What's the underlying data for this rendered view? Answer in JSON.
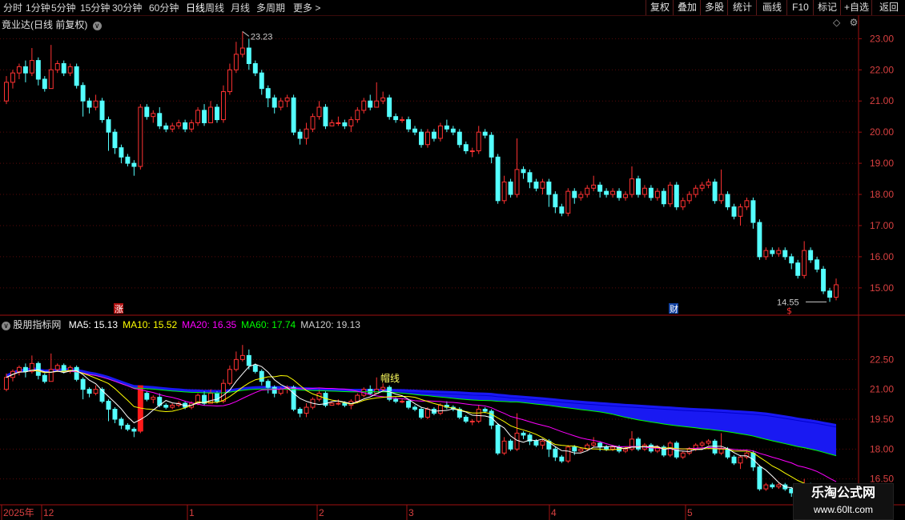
{
  "toolbar": {
    "periods": [
      "分时",
      "1分钟",
      "5分钟",
      "15分钟",
      "30分钟",
      "60分钟",
      "日线",
      "周线",
      "月线",
      "多周期",
      "更多 >"
    ],
    "active_period": "日线",
    "buttons": [
      "复权",
      "叠加",
      "多股",
      "统计",
      "画线",
      "F10",
      "标记",
      "+自选",
      "返回"
    ]
  },
  "main_panel": {
    "title": "竟业达(日线 前复权)",
    "high_label": "23.23",
    "low_label": "14.55",
    "limit_up_tag": "涨",
    "finance_tag": "财",
    "dollar_tag": "$",
    "price_ticks": [
      "23.00",
      "22.00",
      "21.00",
      "20.00",
      "19.00",
      "18.00",
      "17.00",
      "16.00",
      "15.00"
    ]
  },
  "sub_panel": {
    "indicator_name": "股朋指标网",
    "ma_labels": [
      {
        "text": "MA5: 15.13",
        "color": "#ffffff"
      },
      {
        "text": "MA10: 15.52",
        "color": "#ffff00"
      },
      {
        "text": "MA20: 16.35",
        "color": "#ff00ff"
      },
      {
        "text": "MA60: 17.74",
        "color": "#00ff00"
      },
      {
        "text": "MA120: 19.13",
        "color": "#cccccc"
      }
    ],
    "price_ticks": [
      "22.50",
      "21.00",
      "19.50",
      "18.00",
      "16.50"
    ],
    "line_tag": "帽线"
  },
  "time_axis": [
    "2025年",
    "12",
    "1",
    "2",
    "3",
    "4",
    "5"
  ],
  "watermark": {
    "title": "乐淘公式网",
    "url": "www.60lt.com"
  },
  "colors": {
    "up": "#ff3232",
    "down": "#54ffff",
    "axis": "#a01010",
    "ma5": "#ffffff",
    "ma10": "#ffff00",
    "ma20": "#ff00ff",
    "ma60": "#00ff00",
    "band": "#1a1aff"
  },
  "chart_data": {
    "type": "candlestick",
    "title": "竟业达(日线 前复权)",
    "ylim_main": [
      14.2,
      23.6
    ],
    "ylim_sub": [
      15.2,
      23.8
    ],
    "candles": [
      [
        21.0,
        21.6,
        21.8,
        20.9
      ],
      [
        21.6,
        21.9,
        22.0,
        21.4
      ],
      [
        21.9,
        22.1,
        22.2,
        21.7
      ],
      [
        22.1,
        21.9,
        22.3,
        21.6
      ],
      [
        21.9,
        22.3,
        22.7,
        21.8
      ],
      [
        22.3,
        21.7,
        22.4,
        21.5
      ],
      [
        21.7,
        21.4,
        21.8,
        21.3
      ],
      [
        21.4,
        22.0,
        22.8,
        21.4
      ],
      [
        22.0,
        22.2,
        22.3,
        21.9
      ],
      [
        22.2,
        21.9,
        22.3,
        21.8
      ],
      [
        21.9,
        22.1,
        22.2,
        21.8
      ],
      [
        22.1,
        21.5,
        22.2,
        21.4
      ],
      [
        21.5,
        21.0,
        21.6,
        20.5
      ],
      [
        21.0,
        20.8,
        21.1,
        20.6
      ],
      [
        20.8,
        21.0,
        21.2,
        20.7
      ],
      [
        21.0,
        20.4,
        21.1,
        20.3
      ],
      [
        20.4,
        20.0,
        20.5,
        19.4
      ],
      [
        20.0,
        19.5,
        20.1,
        19.3
      ],
      [
        19.5,
        19.2,
        19.6,
        19.0
      ],
      [
        19.2,
        19.0,
        19.3,
        18.9
      ],
      [
        19.0,
        18.9,
        19.1,
        18.6
      ],
      [
        18.9,
        20.8,
        20.9,
        18.8
      ],
      [
        20.8,
        20.5,
        20.9,
        20.4
      ],
      [
        20.5,
        20.6,
        20.7,
        20.3
      ],
      [
        20.6,
        20.2,
        20.8,
        20.1
      ],
      [
        20.2,
        20.1,
        20.3,
        20.0
      ],
      [
        20.1,
        20.2,
        20.3,
        20.0
      ],
      [
        20.2,
        20.3,
        20.4,
        20.1
      ],
      [
        20.3,
        20.1,
        20.4,
        20.0
      ],
      [
        20.1,
        20.3,
        20.4,
        20.0
      ],
      [
        20.3,
        20.7,
        20.8,
        20.2
      ],
      [
        20.7,
        20.3,
        20.9,
        20.2
      ],
      [
        20.3,
        20.8,
        21.0,
        20.3
      ],
      [
        20.8,
        20.4,
        20.9,
        20.3
      ],
      [
        20.4,
        21.3,
        21.5,
        20.3
      ],
      [
        21.3,
        22.0,
        22.2,
        21.2
      ],
      [
        22.0,
        22.5,
        22.9,
        21.9
      ],
      [
        22.5,
        22.7,
        23.23,
        22.4
      ],
      [
        22.7,
        22.2,
        23.0,
        22.0
      ],
      [
        22.2,
        21.9,
        22.3,
        21.8
      ],
      [
        21.9,
        21.4,
        22.0,
        21.2
      ],
      [
        21.4,
        21.1,
        21.5,
        20.8
      ],
      [
        21.1,
        20.8,
        21.2,
        20.6
      ],
      [
        20.8,
        21.0,
        21.1,
        20.7
      ],
      [
        21.0,
        21.1,
        21.2,
        20.8
      ],
      [
        21.1,
        20.0,
        21.2,
        19.9
      ],
      [
        20.0,
        19.8,
        20.1,
        19.6
      ],
      [
        19.8,
        20.1,
        20.3,
        19.6
      ],
      [
        20.1,
        20.5,
        20.6,
        20.0
      ],
      [
        20.5,
        20.8,
        21.0,
        20.4
      ],
      [
        20.8,
        20.2,
        20.9,
        20.1
      ],
      [
        20.2,
        20.3,
        20.4,
        20.2
      ],
      [
        20.3,
        20.3,
        20.5,
        20.2
      ],
      [
        20.3,
        20.2,
        20.4,
        20.1
      ],
      [
        20.2,
        20.4,
        20.5,
        20.0
      ],
      [
        20.4,
        20.7,
        20.8,
        20.3
      ],
      [
        20.7,
        21.0,
        21.1,
        20.6
      ],
      [
        21.0,
        20.8,
        21.2,
        20.7
      ],
      [
        20.8,
        21.0,
        21.6,
        20.8
      ],
      [
        21.0,
        21.1,
        21.3,
        20.9
      ],
      [
        21.1,
        20.5,
        21.2,
        20.4
      ],
      [
        20.5,
        20.4,
        20.6,
        20.3
      ],
      [
        20.4,
        20.4,
        20.5,
        20.3
      ],
      [
        20.4,
        20.1,
        20.5,
        20.0
      ],
      [
        20.1,
        20.0,
        20.2,
        19.9
      ],
      [
        20.0,
        19.6,
        20.1,
        19.5
      ],
      [
        19.6,
        20.0,
        20.1,
        19.5
      ],
      [
        20.0,
        19.8,
        20.1,
        19.7
      ],
      [
        19.8,
        20.2,
        20.3,
        19.7
      ],
      [
        20.2,
        20.1,
        20.4,
        20.0
      ],
      [
        20.1,
        20.0,
        20.2,
        19.9
      ],
      [
        20.0,
        19.6,
        20.1,
        19.5
      ],
      [
        19.6,
        19.4,
        19.7,
        19.3
      ],
      [
        19.4,
        19.4,
        19.5,
        19.2
      ],
      [
        19.4,
        20.0,
        20.2,
        19.3
      ],
      [
        20.0,
        19.9,
        20.1,
        19.8
      ],
      [
        19.9,
        19.2,
        20.0,
        19.0
      ],
      [
        19.2,
        17.8,
        19.3,
        17.7
      ],
      [
        17.8,
        18.4,
        18.6,
        17.7
      ],
      [
        18.4,
        18.0,
        18.5,
        17.9
      ],
      [
        18.0,
        18.8,
        19.8,
        17.9
      ],
      [
        18.8,
        18.7,
        18.9,
        18.5
      ],
      [
        18.7,
        18.4,
        18.8,
        18.2
      ],
      [
        18.4,
        18.2,
        18.5,
        18.1
      ],
      [
        18.2,
        18.4,
        18.5,
        18.0
      ],
      [
        18.4,
        18.0,
        18.5,
        17.6
      ],
      [
        18.0,
        17.6,
        18.1,
        17.4
      ],
      [
        17.6,
        17.4,
        17.7,
        17.3
      ],
      [
        17.4,
        18.1,
        18.2,
        17.3
      ],
      [
        18.1,
        17.9,
        18.2,
        17.7
      ],
      [
        17.9,
        18.0,
        18.1,
        17.8
      ],
      [
        18.0,
        18.2,
        18.3,
        17.9
      ],
      [
        18.2,
        18.3,
        18.6,
        18.1
      ],
      [
        18.3,
        18.1,
        18.4,
        17.9
      ],
      [
        18.1,
        18.0,
        18.2,
        17.9
      ],
      [
        18.0,
        18.1,
        18.2,
        17.9
      ],
      [
        18.1,
        17.9,
        18.2,
        17.8
      ],
      [
        17.9,
        18.0,
        18.1,
        17.8
      ],
      [
        18.0,
        18.5,
        18.9,
        17.9
      ],
      [
        18.5,
        18.0,
        18.6,
        17.9
      ],
      [
        18.0,
        18.2,
        18.3,
        17.9
      ],
      [
        18.2,
        17.9,
        18.3,
        17.8
      ],
      [
        17.9,
        18.1,
        18.2,
        17.8
      ],
      [
        18.1,
        17.7,
        18.2,
        17.6
      ],
      [
        17.7,
        18.3,
        18.4,
        17.6
      ],
      [
        18.3,
        17.6,
        18.4,
        17.5
      ],
      [
        17.6,
        17.8,
        17.9,
        17.5
      ],
      [
        17.8,
        18.0,
        18.1,
        17.7
      ],
      [
        18.0,
        18.2,
        18.3,
        17.9
      ],
      [
        18.2,
        18.3,
        18.4,
        18.1
      ],
      [
        18.3,
        18.4,
        18.5,
        18.2
      ],
      [
        18.4,
        17.8,
        18.5,
        17.7
      ],
      [
        17.8,
        18.0,
        18.8,
        17.7
      ],
      [
        18.0,
        17.6,
        18.1,
        17.5
      ],
      [
        17.6,
        17.3,
        17.7,
        17.2
      ],
      [
        17.3,
        17.6,
        17.7,
        17.0
      ],
      [
        17.6,
        17.8,
        17.9,
        17.5
      ],
      [
        17.8,
        17.1,
        17.9,
        16.9
      ],
      [
        17.1,
        16.0,
        17.2,
        15.9
      ],
      [
        16.0,
        16.2,
        16.3,
        15.9
      ],
      [
        16.2,
        16.1,
        16.3,
        16.0
      ],
      [
        16.1,
        16.2,
        16.3,
        16.0
      ],
      [
        16.2,
        16.0,
        16.3,
        15.9
      ],
      [
        16.0,
        15.8,
        16.1,
        15.6
      ],
      [
        15.8,
        15.4,
        15.9,
        15.3
      ],
      [
        15.4,
        16.2,
        16.5,
        15.3
      ],
      [
        16.2,
        15.9,
        16.3,
        15.8
      ],
      [
        15.9,
        15.6,
        16.0,
        15.5
      ],
      [
        15.6,
        14.9,
        15.7,
        14.8
      ],
      [
        14.9,
        14.7,
        15.0,
        14.55
      ],
      [
        14.7,
        15.1,
        15.3,
        14.6
      ]
    ]
  }
}
